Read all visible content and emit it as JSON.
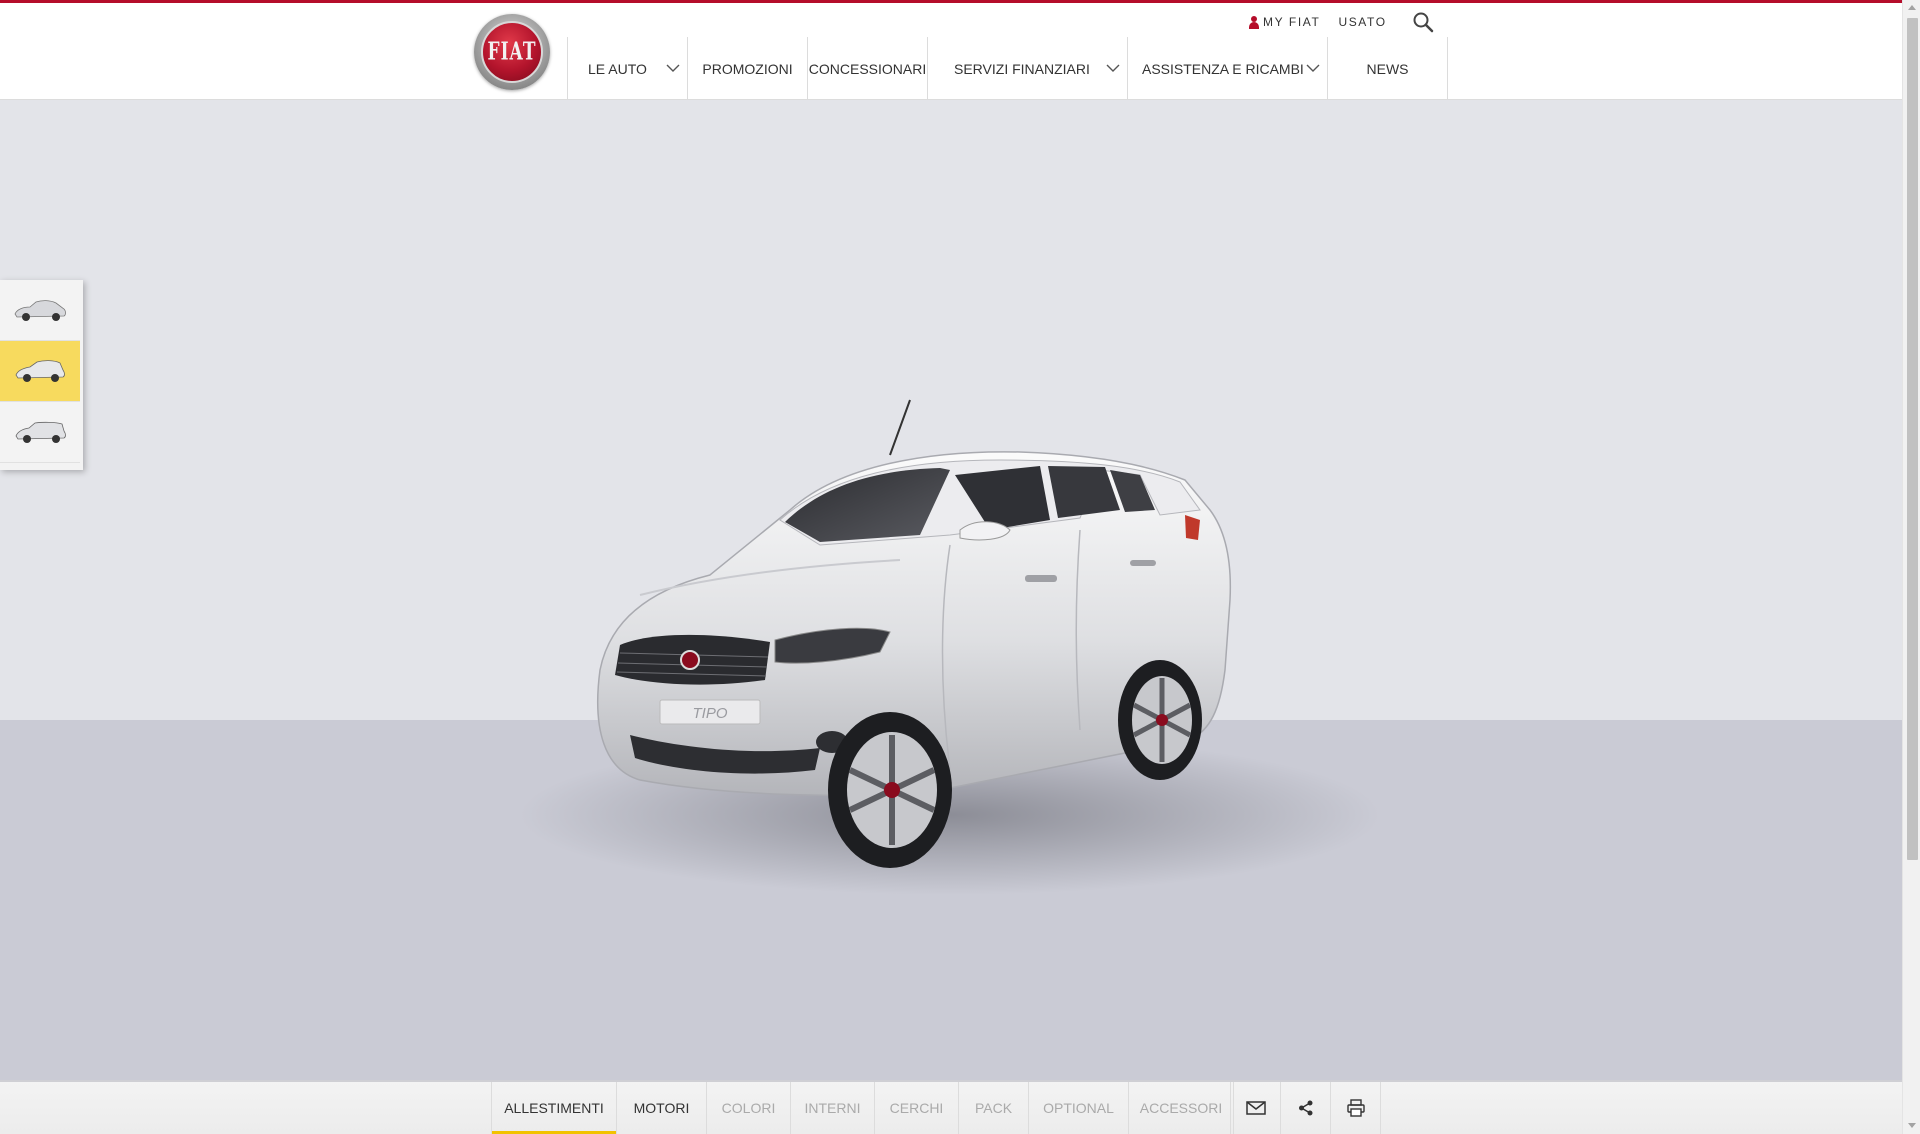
{
  "brand": {
    "logo_text": "FIAT"
  },
  "utility": {
    "my_fiat": "MY FIAT",
    "usato": "USATO"
  },
  "nav": {
    "items": [
      {
        "label": "LE AUTO",
        "has_dropdown": true
      },
      {
        "label": "PROMOZIONI",
        "has_dropdown": false
      },
      {
        "label": "CONCESSIONARI",
        "has_dropdown": false
      },
      {
        "label": "SERVIZI FINANZIARI",
        "has_dropdown": true
      },
      {
        "label": "ASSISTENZA E RICAMBI",
        "has_dropdown": true
      },
      {
        "label": "NEWS",
        "has_dropdown": false
      }
    ]
  },
  "model": {
    "badge_text": "TIPO"
  },
  "body_selector": {
    "thumbs": [
      {
        "icon": "sedan-icon",
        "active": false
      },
      {
        "icon": "hatchback-icon",
        "active": true
      },
      {
        "icon": "station-wagon-icon",
        "active": false
      }
    ]
  },
  "tabs": {
    "items": [
      {
        "label": "ALLESTIMENTI",
        "state": "active"
      },
      {
        "label": "MOTORI",
        "state": "enabled"
      },
      {
        "label": "COLORI",
        "state": "disabled"
      },
      {
        "label": "INTERNI",
        "state": "disabled"
      },
      {
        "label": "CERCHI",
        "state": "disabled"
      },
      {
        "label": "PACK",
        "state": "disabled"
      },
      {
        "label": "OPTIONAL",
        "state": "disabled"
      },
      {
        "label": "ACCESSORI",
        "state": "disabled"
      }
    ]
  },
  "tools": [
    "mail-icon",
    "share-icon",
    "print-icon"
  ],
  "colors": {
    "brand_red": "#b50d2a",
    "active_tab_underline": "#f2c200",
    "active_thumb": "#f7da5e"
  }
}
